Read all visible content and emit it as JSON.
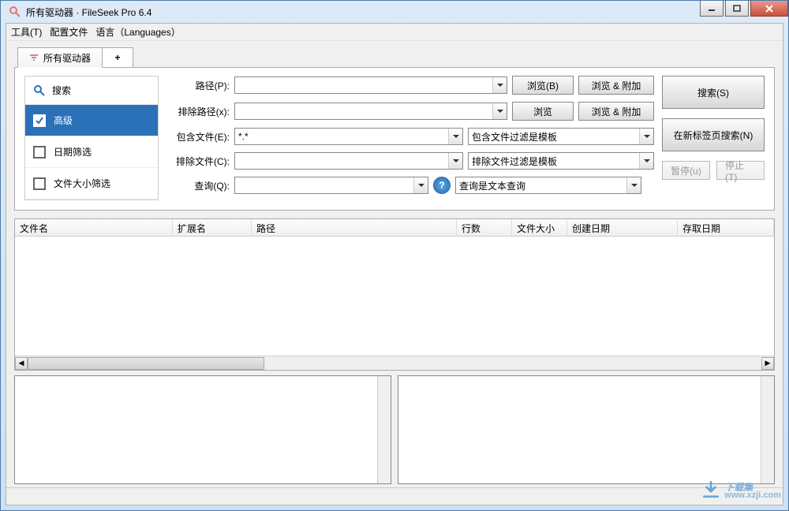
{
  "window": {
    "title": "所有驱动器 · FileSeek Pro 6.4"
  },
  "menu": {
    "tools": "工具(T)",
    "profiles": "配置文件",
    "languages": "语言（Languages）"
  },
  "tabs": {
    "active": "所有驱动器",
    "add": "+"
  },
  "sidebar": {
    "search_head": "搜索",
    "items": [
      {
        "label": "高级",
        "checked": true
      },
      {
        "label": "日期筛选",
        "checked": false
      },
      {
        "label": "文件大小筛选",
        "checked": false
      }
    ]
  },
  "form": {
    "path_label": "路径(P):",
    "exclude_path_label": "排除路径(x):",
    "include_files_label": "包含文件(E):",
    "include_files_value": "*.*",
    "exclude_files_label": "排除文件(C):",
    "query_label": "查询(Q):",
    "browse_b": "浏览(B)",
    "browse": "浏览",
    "browse_add": "浏览 & 附加",
    "include_filter": "包含文件过滤是模板",
    "exclude_filter": "排除文件过滤是模板",
    "query_mode": "查询是文本查询",
    "help": "?"
  },
  "actions": {
    "search": "搜索(S)",
    "new_tab_search": "在新标签页搜索(N)",
    "pause": "暂停(u)",
    "stop": "停止(T)"
  },
  "columns": {
    "filename": "文件名",
    "ext": "扩展名",
    "path": "路径",
    "lines": "行数",
    "size": "文件大小",
    "created": "创建日期",
    "accessed": "存取日期"
  },
  "watermark": {
    "brand": "下载集",
    "url": "www.xzji.com"
  }
}
